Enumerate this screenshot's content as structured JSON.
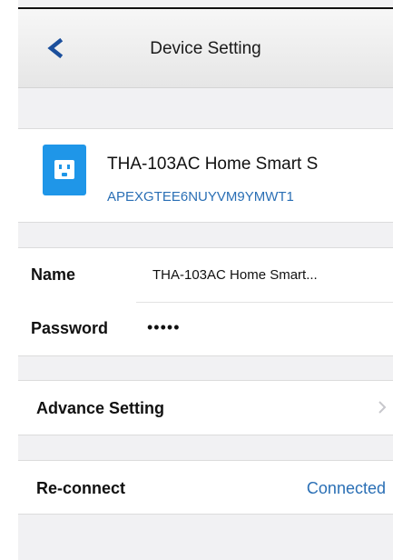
{
  "navbar": {
    "title": "Device Setting",
    "back_icon": "chevron-left-icon"
  },
  "device": {
    "icon": "smart-plug-icon",
    "name": "THA-103AC Home Smart S",
    "id": "APEXGTEE6NUYVM9YMWT1"
  },
  "fields": {
    "name_label": "Name",
    "name_value": "THA-103AC Home Smart...",
    "password_label": "Password",
    "password_value": "•••••"
  },
  "advance": {
    "label": "Advance Setting",
    "icon": "chevron-right-icon"
  },
  "reconnect": {
    "label": "Re-connect",
    "status": "Connected"
  },
  "colors": {
    "accent": "#1f96e8",
    "link": "#2a6fb5",
    "background": "#f1f1f3"
  }
}
